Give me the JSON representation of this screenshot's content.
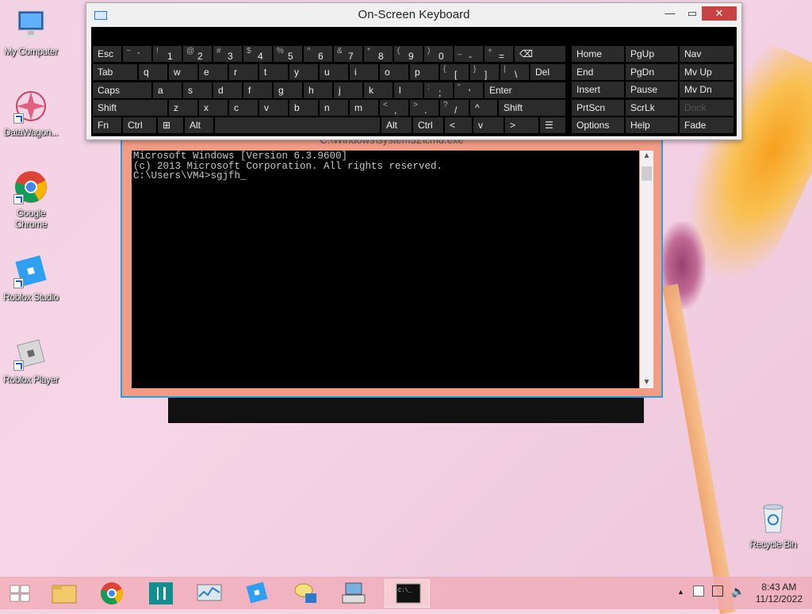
{
  "desktop": {
    "icons": [
      {
        "label": "My Computer"
      },
      {
        "label": "DataWagon..."
      },
      {
        "label": "Google Chrome"
      },
      {
        "label": "Roblox Studio"
      },
      {
        "label": "Roblox Player"
      },
      {
        "label": "Recycle Bin"
      }
    ]
  },
  "osk": {
    "title": "On-Screen Keyboard",
    "minimize": "—",
    "maximize": "▭",
    "close": "✕",
    "row1": [
      {
        "main": "Esc"
      },
      {
        "sub": "~",
        "main": "`"
      },
      {
        "sub": "!",
        "main": "1"
      },
      {
        "sub": "@",
        "main": "2"
      },
      {
        "sub": "#",
        "main": "3"
      },
      {
        "sub": "$",
        "main": "4"
      },
      {
        "sub": "%",
        "main": "5"
      },
      {
        "sub": "^",
        "main": "6"
      },
      {
        "sub": "&",
        "main": "7"
      },
      {
        "sub": "*",
        "main": "8"
      },
      {
        "sub": "(",
        "main": "9"
      },
      {
        "sub": ")",
        "main": "0"
      },
      {
        "sub": "_",
        "main": "-"
      },
      {
        "sub": "+",
        "main": "="
      },
      {
        "main": "⌫"
      }
    ],
    "row2": [
      {
        "main": "Tab"
      },
      {
        "main": "q"
      },
      {
        "main": "w"
      },
      {
        "main": "e"
      },
      {
        "main": "r"
      },
      {
        "main": "t"
      },
      {
        "main": "y"
      },
      {
        "main": "u"
      },
      {
        "main": "i"
      },
      {
        "main": "o"
      },
      {
        "main": "p"
      },
      {
        "sub": "{",
        "main": "["
      },
      {
        "sub": "}",
        "main": "]"
      },
      {
        "sub": "|",
        "main": "\\"
      },
      {
        "main": "Del"
      }
    ],
    "row3": [
      {
        "main": "Caps"
      },
      {
        "main": "a"
      },
      {
        "main": "s"
      },
      {
        "main": "d"
      },
      {
        "main": "f"
      },
      {
        "main": "g"
      },
      {
        "main": "h"
      },
      {
        "main": "j"
      },
      {
        "main": "k"
      },
      {
        "main": "l"
      },
      {
        "sub": ":",
        "main": ";"
      },
      {
        "sub": "\"",
        "main": "'"
      },
      {
        "main": "Enter"
      }
    ],
    "row4": [
      {
        "main": "Shift"
      },
      {
        "main": "z"
      },
      {
        "main": "x"
      },
      {
        "main": "c"
      },
      {
        "main": "v"
      },
      {
        "main": "b"
      },
      {
        "main": "n"
      },
      {
        "main": "m"
      },
      {
        "sub": "<",
        "main": ","
      },
      {
        "sub": ">",
        "main": "."
      },
      {
        "sub": "?",
        "main": "/"
      },
      {
        "main": "^"
      },
      {
        "main": "Shift"
      }
    ],
    "row5": [
      {
        "main": "Fn"
      },
      {
        "main": "Ctrl"
      },
      {
        "main": "⊞"
      },
      {
        "main": "Alt"
      },
      {
        "main": ""
      },
      {
        "main": "Alt"
      },
      {
        "main": "Ctrl"
      },
      {
        "main": "<"
      },
      {
        "main": "v"
      },
      {
        "main": ">"
      },
      {
        "main": "☰"
      }
    ],
    "nav": [
      [
        "Home",
        "PgUp",
        "Nav"
      ],
      [
        "End",
        "PgDn",
        "Mv Up"
      ],
      [
        "Insert",
        "Pause",
        "Mv Dn"
      ],
      [
        "PrtScn",
        "ScrLk",
        "Dock"
      ],
      [
        "Options",
        "Help",
        "Fade"
      ]
    ]
  },
  "cmd": {
    "title": "C:\\Windows\\system32\\cmd.exe",
    "lines": [
      "Microsoft Windows [Version 6.3.9600]",
      "(c) 2013 Microsoft Corporation. All rights reserved.",
      "C:\\Users\\VM4>sgjfh_"
    ]
  },
  "taskbar": {
    "clock_time": "8:43 AM",
    "clock_date": "11/12/2022"
  },
  "colors": {
    "accent": "#28a0e0",
    "cmd_frame": "#f29c86",
    "close_red": "#c74343"
  }
}
